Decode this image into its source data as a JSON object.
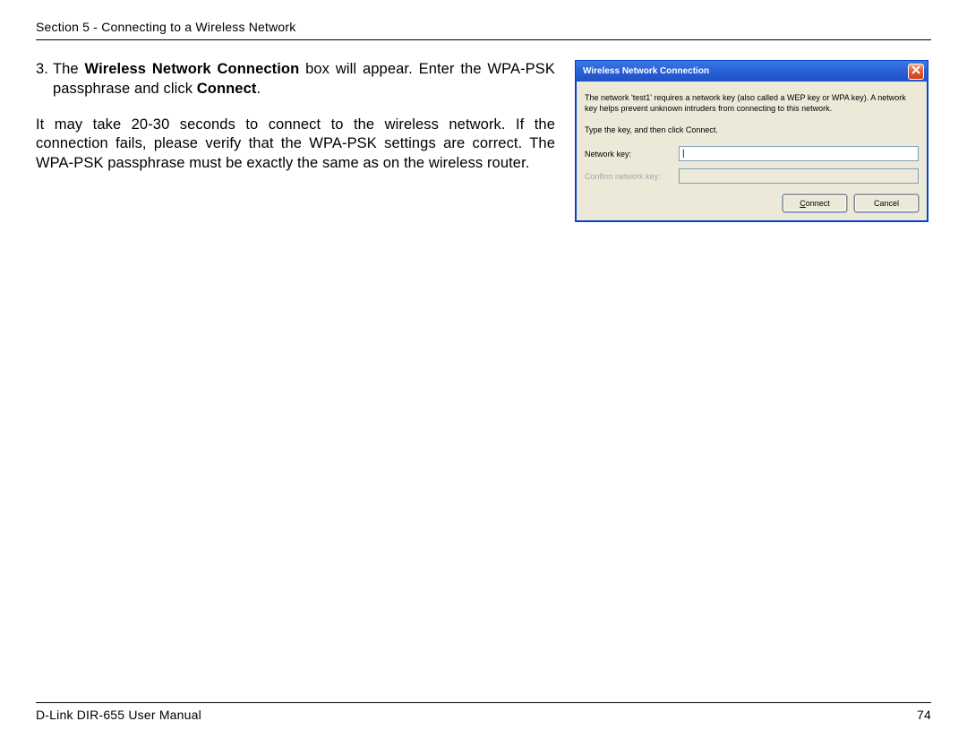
{
  "header": "Section 5 - Connecting to a Wireless Network",
  "step": {
    "num": "3.",
    "lead": "The ",
    "bold1": "Wireless Network Connection",
    "mid": " box will appear. Enter the WPA-PSK passphrase and click ",
    "bold2": "Connect",
    "end": "."
  },
  "para2": "It may take 20-30 seconds to connect to the wireless network. If the connection fails, please verify that the WPA-PSK settings are correct. The WPA-PSK passphrase must be exactly the same as on the wireless router.",
  "dialog": {
    "title": "Wireless Network Connection",
    "close": "X",
    "desc": "The network 'test1' requires a network key (also called a WEP key or WPA key). A network key helps prevent unknown intruders from connecting to this network.",
    "instruction": "Type the key, and then click Connect.",
    "label_key": "Network key:",
    "label_confirm": "Confirm network key:",
    "input_value": "|",
    "btn_connect_u": "C",
    "btn_connect_rest": "onnect",
    "btn_cancel": "Cancel"
  },
  "footer": {
    "left": "D-Link DIR-655 User Manual",
    "right": "74"
  }
}
